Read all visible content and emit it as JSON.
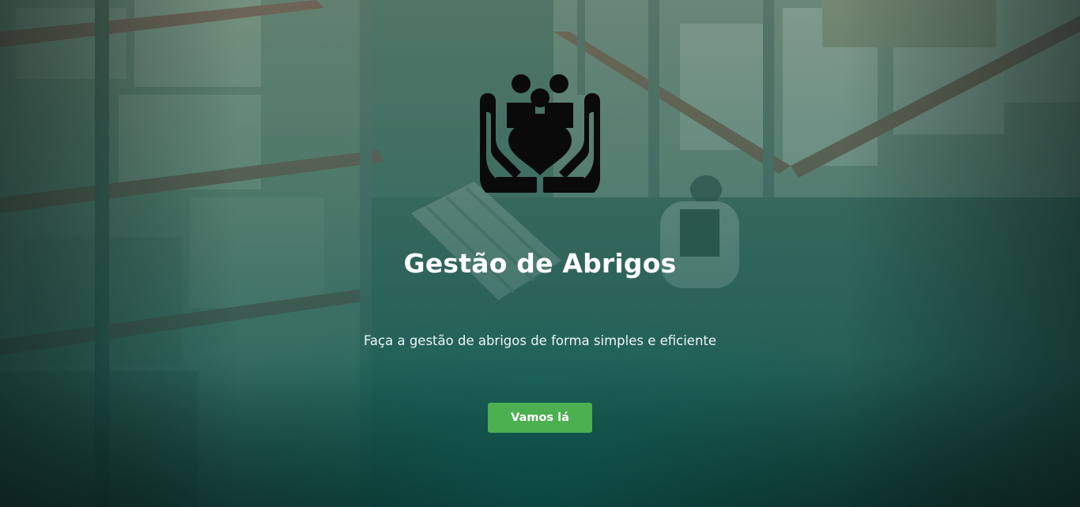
{
  "hero": {
    "logo_icon": "hands-holding-people-heart-icon",
    "title": "Gestão de Abrigos",
    "subtitle": "Faça a gestão de abrigos de forma simples e eficiente",
    "cta_label": "Vamos lá"
  },
  "colors": {
    "overlay_teal": "#14786f",
    "cta_green": "#4caf50",
    "text": "#ffffff",
    "logo": "#0a0a0a"
  }
}
